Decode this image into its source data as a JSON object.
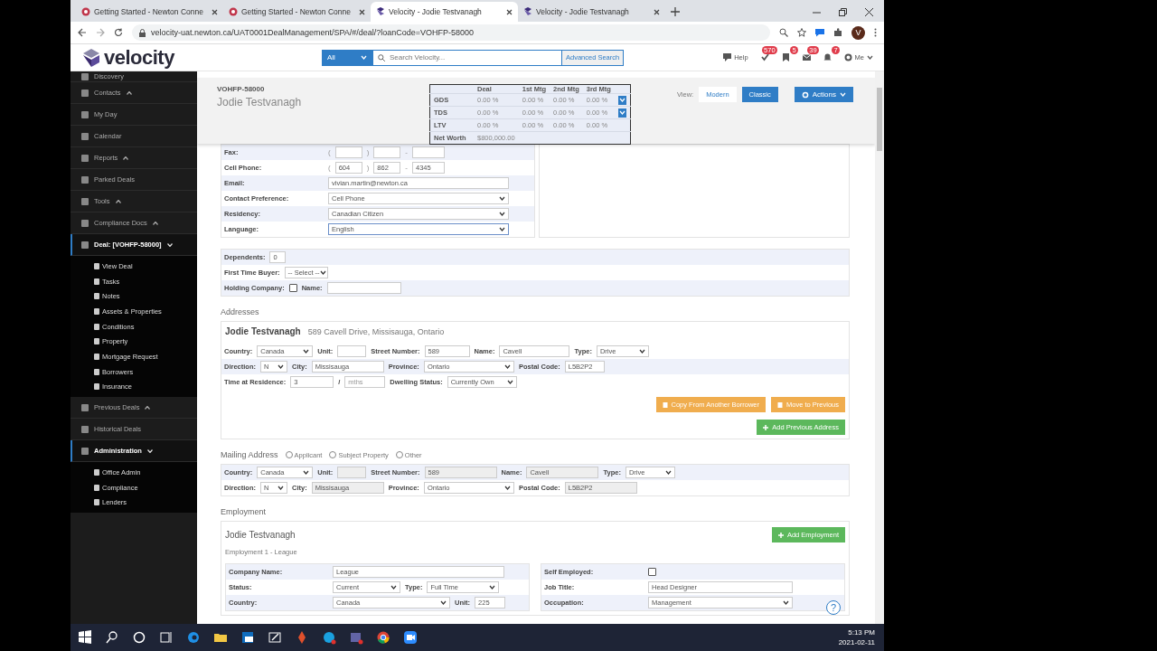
{
  "browser": {
    "tabs": [
      {
        "title": "Getting Started - Newton Conne",
        "selected": false,
        "kind": "newton"
      },
      {
        "title": "Getting Started - Newton Conne",
        "selected": false,
        "kind": "newton"
      },
      {
        "title": "Velocity - Jodie Testvanagh",
        "selected": true,
        "kind": "velocity"
      },
      {
        "title": "Velocity - Jodie Testvanagh",
        "selected": false,
        "kind": "velocity"
      }
    ],
    "url": "velocity-uat.newton.ca/UAT0001DealManagement/SPA/#/deal/?loanCode=VOHFP-58000",
    "profile_initial": "V"
  },
  "app_header": {
    "logo": "velocity",
    "search_scope": "All",
    "search_placeholder": "Search Velocity...",
    "advanced_search": "Advanced Search",
    "help": "Help",
    "badges": [
      "570",
      "5",
      "39",
      "7"
    ],
    "user": "Me"
  },
  "sidebar": {
    "items": [
      {
        "label": "Discovery",
        "kind": "link",
        "selected": false
      },
      {
        "label": "Contacts",
        "kind": "group",
        "expanded": false,
        "selected": false
      },
      {
        "label": "My Day",
        "kind": "link",
        "selected": false
      },
      {
        "label": "Calendar",
        "kind": "link",
        "selected": false
      },
      {
        "label": "Reports",
        "kind": "group",
        "expanded": false,
        "selected": false
      },
      {
        "label": "Parked Deals",
        "kind": "link",
        "selected": false
      },
      {
        "label": "Tools",
        "kind": "group",
        "expanded": false,
        "selected": false
      },
      {
        "label": "Compliance Docs",
        "kind": "group",
        "expanded": false,
        "selected": false
      },
      {
        "label": "Deal: [VOHFP-58000]",
        "kind": "group",
        "expanded": true,
        "selected": true,
        "children": [
          {
            "label": "View Deal"
          },
          {
            "label": "Tasks"
          },
          {
            "label": "Notes"
          },
          {
            "label": "Assets & Properties"
          },
          {
            "label": "Conditions"
          },
          {
            "label": "Property"
          },
          {
            "label": "Mortgage Request"
          },
          {
            "label": "Borrowers"
          },
          {
            "label": "Insurance"
          }
        ]
      },
      {
        "label": "Previous Deals",
        "kind": "group",
        "expanded": false,
        "selected": false
      },
      {
        "label": "Historical Deals",
        "kind": "link",
        "selected": false
      },
      {
        "label": "Administration",
        "kind": "group",
        "expanded": true,
        "selected": true,
        "children": [
          {
            "label": "Office Admin"
          },
          {
            "label": "Compliance"
          },
          {
            "label": "Lenders"
          }
        ]
      }
    ]
  },
  "deal_header": {
    "code": "VOHFP-58000",
    "name": "Jodie Testvanagh",
    "ratios": {
      "columns": [
        "Deal",
        "1st Mtg",
        "2nd Mtg",
        "3rd Mtg"
      ],
      "rows": [
        {
          "label": "GDS",
          "values": [
            "0.00 %",
            "0.00 %",
            "0.00 %",
            "0.00 %"
          ],
          "dropdown": true
        },
        {
          "label": "TDS",
          "values": [
            "0.00 %",
            "0.00 %",
            "0.00 %",
            "0.00 %"
          ],
          "dropdown": true
        },
        {
          "label": "LTV",
          "values": [
            "0.00 %",
            "0.00 %",
            "0.00 %",
            "0.00 %"
          ],
          "dropdown": false
        },
        {
          "label": "Net Worth",
          "values": [
            "$800,000.00"
          ],
          "dropdown": false
        }
      ]
    },
    "view_label": "View:",
    "view_options": [
      {
        "label": "Modern",
        "selected": false
      },
      {
        "label": "Classic",
        "selected": true
      }
    ],
    "actions": "Actions"
  },
  "contact_rows": [
    {
      "label": "Fax:",
      "kind": "phone",
      "marks": [
        "(",
        ")",
        "-"
      ]
    },
    {
      "label": "Cell Phone:",
      "kind": "phone",
      "parts": [
        "604",
        "862",
        "4345"
      ],
      "marks": [
        "(",
        ")",
        "-"
      ]
    },
    {
      "label": "Email:",
      "kind": "text",
      "value": "vivian.martin@newton.ca"
    },
    {
      "label": "Contact Preference:",
      "kind": "select",
      "value": "Cell Phone"
    },
    {
      "label": "Residency:",
      "kind": "select",
      "value": "Canadian Citizen"
    },
    {
      "label": "Language:",
      "kind": "select",
      "value": "English",
      "focused": true
    }
  ],
  "extra_rows": [
    [
      {
        "label": "Dependents:",
        "kind": "text",
        "value": "0"
      }
    ],
    [
      {
        "label": "First Time Buyer:",
        "kind": "select",
        "value": "-- Select --"
      }
    ],
    [
      {
        "label": "Holding Company:",
        "kind": "checkbox",
        "checked": false
      },
      {
        "label": "Name:",
        "kind": "text"
      }
    ]
  ],
  "addresses": {
    "heading": "Addresses",
    "name": "Jodie Testvanagh",
    "address": "589 Cavell Drive, Missisauga, Ontario",
    "rows": [
      [
        {
          "label": "Country:",
          "kind": "select",
          "value": "Canada"
        },
        {
          "label": "Unit:",
          "kind": "text"
        },
        {
          "label": "Street Number:",
          "kind": "text",
          "value": "589"
        },
        {
          "label": "Name:",
          "kind": "text",
          "value": "Cavell"
        },
        {
          "label": "Type:",
          "kind": "select",
          "value": "Drive"
        }
      ],
      [
        {
          "label": "Direction:",
          "kind": "select",
          "value": "N"
        },
        {
          "label": "City:",
          "kind": "text",
          "value": "Missisauga"
        },
        {
          "label": "Province:",
          "kind": "select",
          "value": "Ontario"
        },
        {
          "label": "Postal Code:",
          "kind": "text",
          "value": "L5B2P2"
        }
      ],
      [
        {
          "label": "Time at Residence:",
          "kind": "text",
          "value": "3"
        },
        {
          "label": "/",
          "kind": "text",
          "placeholder": "mths"
        },
        {
          "label": "Dwelling Status:",
          "kind": "select",
          "value": "Currently Own"
        }
      ]
    ],
    "buttons": [
      {
        "label": "Copy From Another Borrower",
        "kind": "warning"
      },
      {
        "label": "Move to Previous",
        "kind": "warning"
      },
      {
        "label": "Add Previous Address",
        "kind": "success"
      }
    ]
  },
  "mailing": {
    "heading": "Mailing Address",
    "options": [
      {
        "label": "Applicant",
        "selected": false
      },
      {
        "label": "Subject Property",
        "selected": false
      },
      {
        "label": "Other",
        "selected": false
      }
    ],
    "rows": [
      [
        {
          "label": "Country:",
          "kind": "select",
          "value": "Canada"
        },
        {
          "label": "Unit:",
          "kind": "text",
          "disabled": true
        },
        {
          "label": "Street Number:",
          "kind": "text",
          "value": "589",
          "disabled": true
        },
        {
          "label": "Name:",
          "kind": "text",
          "value": "Cavell",
          "disabled": true
        },
        {
          "label": "Type:",
          "kind": "select",
          "value": "Drive"
        }
      ],
      [
        {
          "label": "Direction:",
          "kind": "select",
          "value": "N"
        },
        {
          "label": "City:",
          "kind": "text",
          "value": "Missisauga",
          "disabled": true
        },
        {
          "label": "Province:",
          "kind": "select",
          "value": "Ontario"
        },
        {
          "label": "Postal Code:",
          "kind": "text",
          "value": "L5B2P2",
          "disabled": true
        }
      ]
    ]
  },
  "employment": {
    "heading": "Employment",
    "name": "Jodie Testvanagh",
    "add_button": "Add Employment",
    "subtitle": "Employment 1 - League",
    "left_rows": [
      [
        {
          "label": "Company Name:",
          "kind": "text",
          "value": "League"
        }
      ],
      [
        {
          "label": "Status:",
          "kind": "select",
          "value": "Current"
        },
        {
          "label": "Type:",
          "kind": "select",
          "value": "Full Time"
        }
      ],
      [
        {
          "label": "Country:",
          "kind": "select",
          "value": "Canada"
        },
        {
          "label": "Unit:",
          "kind": "text",
          "value": "225"
        }
      ]
    ],
    "right_rows": [
      [
        {
          "label": "Self Employed:",
          "kind": "checkbox",
          "checked": false
        }
      ],
      [
        {
          "label": "Job Title:",
          "kind": "text",
          "value": "Head Designer"
        }
      ],
      [
        {
          "label": "Occupation:",
          "kind": "select",
          "value": "Management"
        }
      ]
    ],
    "help": "?"
  },
  "taskbar": {
    "time": "5:13 PM",
    "date": "2021-02-11"
  }
}
